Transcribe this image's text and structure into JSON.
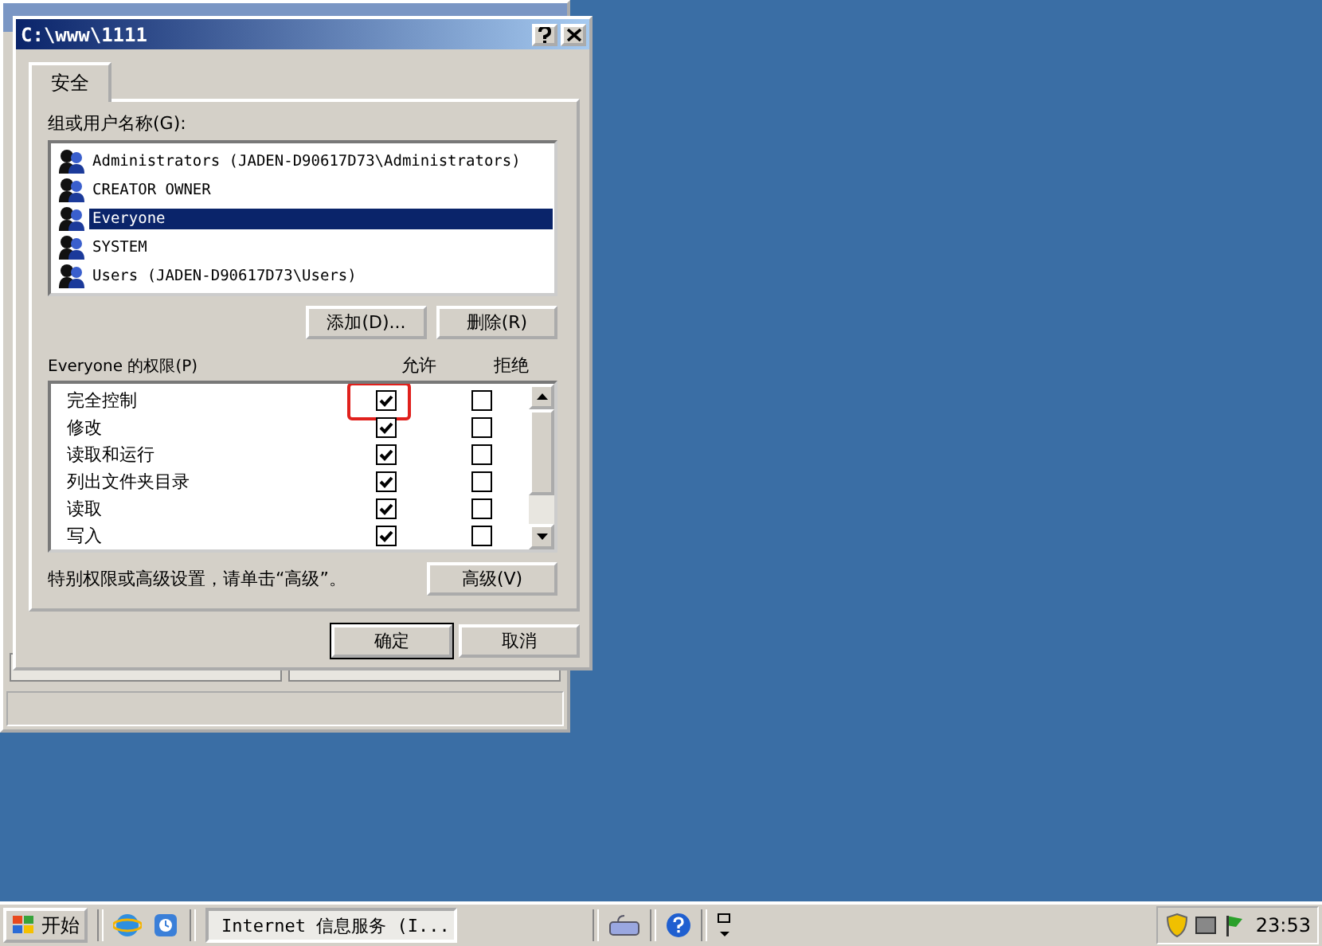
{
  "dialog": {
    "title": "C:\\www\\1111",
    "tabs": [
      {
        "label": "安全",
        "selected": true
      }
    ],
    "groups_label": "组或用户名称(G):",
    "groups": [
      {
        "name": "Administrators (JADEN-D90617D73\\Administrators)",
        "selected": false
      },
      {
        "name": "CREATOR OWNER",
        "selected": false
      },
      {
        "name": "Everyone",
        "selected": true
      },
      {
        "name": "SYSTEM",
        "selected": false
      },
      {
        "name": "Users (JADEN-D90617D73\\Users)",
        "selected": false
      }
    ],
    "group_buttons": [
      "添加(D)...",
      "删除(R)"
    ],
    "permissions_label": "Everyone 的权限(P)",
    "allow_header": "允许",
    "deny_header": "拒绝",
    "permissions": [
      {
        "name": "完全控制",
        "allow": true,
        "deny": false,
        "highlighted": true
      },
      {
        "name": "修改",
        "allow": true,
        "deny": false,
        "highlighted": false
      },
      {
        "name": "读取和运行",
        "allow": true,
        "deny": false,
        "highlighted": false
      },
      {
        "name": "列出文件夹目录",
        "allow": true,
        "deny": false,
        "highlighted": false
      },
      {
        "name": "读取",
        "allow": true,
        "deny": false,
        "highlighted": false
      },
      {
        "name": "写入",
        "allow": true,
        "deny": false,
        "highlighted": false
      }
    ],
    "advanced_hint": "特别权限或高级设置，请单击“高级”。",
    "advanced_button": "高级(V)",
    "buttons": [
      "确定",
      "取消"
    ]
  },
  "taskbar": {
    "start": "开始",
    "tasks": [
      {
        "label": "Internet 信息服务 (I...",
        "selected": true
      }
    ],
    "clock": "23:53"
  }
}
